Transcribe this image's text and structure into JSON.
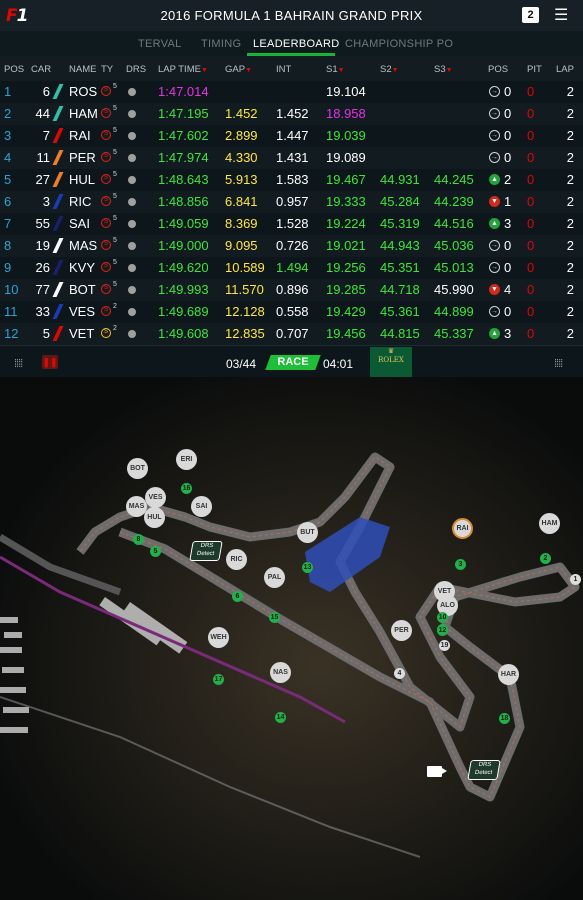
{
  "header": {
    "title": "2016 FORMULA 1 BAHRAIN GRAND PRIX",
    "badge": "2"
  },
  "tabs": [
    "TERVAL",
    "TIMING",
    "LEADERBOARD",
    "CHAMPIONSHIP PO"
  ],
  "columns": {
    "pos": "POS",
    "car": "CAR",
    "name": "NAME",
    "ty": "TY",
    "drs": "DRS",
    "lap_time": "LAP TIME",
    "gap": "GAP",
    "int": "INT",
    "s1": "S1",
    "s2": "S2",
    "s3": "S3",
    "pos_change": "POS",
    "pit": "PIT",
    "lap": "LAP"
  },
  "rows": [
    {
      "pos": "1",
      "car": "6",
      "name": "ROS",
      "team_color": "#2fbfa8",
      "tyre_label": "S",
      "tyre": "super",
      "tyre_laps": "5",
      "lap_time": "1:47.014",
      "lap_purple": true,
      "gap": "",
      "int": "",
      "s1": "19.104",
      "s1_style": "white",
      "s2": "",
      "s3": "",
      "pos_dir": "same",
      "pos_change": "0",
      "pit": "0",
      "lap": "2"
    },
    {
      "pos": "2",
      "car": "44",
      "name": "HAM",
      "team_color": "#2fbfa8",
      "tyre_label": "S",
      "tyre": "super",
      "tyre_laps": "5",
      "lap_time": "1:47.195",
      "lap_purple": false,
      "gap": "1.452",
      "int": "1.452",
      "s1": "18.958",
      "s1_style": "purple",
      "s2": "",
      "s3": "",
      "pos_dir": "same",
      "pos_change": "0",
      "pit": "0",
      "lap": "2"
    },
    {
      "pos": "3",
      "car": "7",
      "name": "RAI",
      "team_color": "#e10600",
      "tyre_label": "S",
      "tyre": "super",
      "tyre_laps": "5",
      "lap_time": "1:47.602",
      "lap_purple": false,
      "gap": "2.899",
      "int": "1.447",
      "s1": "19.039",
      "s1_style": "green",
      "s2": "",
      "s3": "",
      "pos_dir": "same",
      "pos_change": "0",
      "pit": "0",
      "lap": "2"
    },
    {
      "pos": "4",
      "car": "11",
      "name": "PER",
      "team_color": "#f47d20",
      "tyre_label": "S",
      "tyre": "super",
      "tyre_laps": "5",
      "lap_time": "1:47.974",
      "lap_purple": false,
      "gap": "4.330",
      "int": "1.431",
      "s1": "19.089",
      "s1_style": "white",
      "s2": "",
      "s3": "",
      "pos_dir": "same",
      "pos_change": "0",
      "pit": "0",
      "lap": "2"
    },
    {
      "pos": "5",
      "car": "27",
      "name": "HUL",
      "team_color": "#f47d20",
      "tyre_label": "S",
      "tyre": "super",
      "tyre_laps": "5",
      "lap_time": "1:48.643",
      "lap_purple": false,
      "gap": "5.913",
      "int": "1.583",
      "s1": "19.467",
      "s1_style": "green",
      "s2": "44.931",
      "s3": "44.245",
      "s3_style": "green",
      "pos_dir": "up",
      "pos_change": "2",
      "pit": "0",
      "lap": "2"
    },
    {
      "pos": "6",
      "car": "3",
      "name": "RIC",
      "team_color": "#1c3bb8",
      "tyre_label": "S",
      "tyre": "super",
      "tyre_laps": "5",
      "lap_time": "1:48.856",
      "lap_purple": false,
      "gap": "6.841",
      "int": "0.957",
      "s1": "19.333",
      "s1_style": "green",
      "s2": "45.284",
      "s3": "44.239",
      "s3_style": "green",
      "pos_dir": "down",
      "pos_change": "1",
      "pit": "0",
      "lap": "2"
    },
    {
      "pos": "7",
      "car": "55",
      "name": "SAI",
      "team_color": "#1a1f6b",
      "tyre_label": "S",
      "tyre": "super",
      "tyre_laps": "5",
      "lap_time": "1:49.059",
      "lap_purple": false,
      "gap": "8.369",
      "int": "1.528",
      "s1": "19.224",
      "s1_style": "green",
      "s2": "45.319",
      "s3": "44.516",
      "s3_style": "green",
      "pos_dir": "up",
      "pos_change": "3",
      "pit": "0",
      "lap": "2"
    },
    {
      "pos": "8",
      "car": "19",
      "name": "MAS",
      "team_color": "#ffffff",
      "tyre_label": "S",
      "tyre": "super",
      "tyre_laps": "5",
      "lap_time": "1:49.000",
      "lap_purple": false,
      "gap": "9.095",
      "int": "0.726",
      "s1": "19.021",
      "s1_style": "green",
      "s2": "44.943",
      "s3": "45.036",
      "s3_style": "green",
      "pos_dir": "same",
      "pos_change": "0",
      "pit": "0",
      "lap": "2"
    },
    {
      "pos": "9",
      "car": "26",
      "name": "KVY",
      "team_color": "#1a1f6b",
      "tyre_label": "S",
      "tyre": "super",
      "tyre_laps": "5",
      "lap_time": "1:49.620",
      "lap_purple": false,
      "gap": "10.589",
      "int": "1.494",
      "int_style": "green",
      "s1": "19.256",
      "s1_style": "green",
      "s2": "45.351",
      "s3": "45.013",
      "s3_style": "green",
      "pos_dir": "same",
      "pos_change": "0",
      "pit": "0",
      "lap": "2"
    },
    {
      "pos": "10",
      "car": "77",
      "name": "BOT",
      "team_color": "#ffffff",
      "tyre_label": "S",
      "tyre": "super",
      "tyre_laps": "5",
      "lap_time": "1:49.993",
      "lap_purple": false,
      "gap": "11.570",
      "int": "0.896",
      "s1": "19.285",
      "s1_style": "green",
      "s2": "44.718",
      "s3": "45.990",
      "s3_style": "white",
      "pos_dir": "down",
      "pos_change": "4",
      "pit": "0",
      "lap": "2"
    },
    {
      "pos": "11",
      "car": "33",
      "name": "VES",
      "team_color": "#1c3bb8",
      "tyre_label": "S",
      "tyre": "super",
      "tyre_laps": "2",
      "lap_time": "1:49.689",
      "lap_purple": false,
      "gap": "12.128",
      "int": "0.558",
      "s1": "19.429",
      "s1_style": "green",
      "s2": "45.361",
      "s3": "44.899",
      "s3_style": "green",
      "pos_dir": "same",
      "pos_change": "0",
      "pit": "0",
      "lap": "2"
    },
    {
      "pos": "12",
      "car": "5",
      "name": "VET",
      "team_color": "#e10600",
      "tyre_label": "S",
      "tyre": "soft",
      "tyre_laps": "2",
      "lap_time": "1:49.608",
      "lap_purple": false,
      "gap": "12.835",
      "int": "0.707",
      "s1": "19.456",
      "s1_style": "green",
      "s2": "44.815",
      "s3": "45.337",
      "s3_style": "green",
      "pos_dir": "up",
      "pos_change": "3",
      "pit": "0",
      "lap": "2"
    }
  ],
  "footer": {
    "laps": "03/44",
    "status": "RACE",
    "clock": "04:01",
    "sponsor": "ROLEX"
  },
  "map": {
    "drivers": [
      "BOT",
      "ERI",
      "VES",
      "MAS",
      "HUL",
      "SAI",
      "BUT",
      "RIC",
      "PAL",
      "WEH",
      "NAS",
      "PER",
      "VET",
      "ALO",
      "HAR",
      "RAI",
      "HAM"
    ],
    "turns": [
      "1",
      "2",
      "3",
      "4",
      "5",
      "6",
      "8",
      "10",
      "11",
      "12",
      "13",
      "14",
      "15",
      "16",
      "17",
      "18",
      "19"
    ],
    "drs_label": "DRS Detect"
  }
}
